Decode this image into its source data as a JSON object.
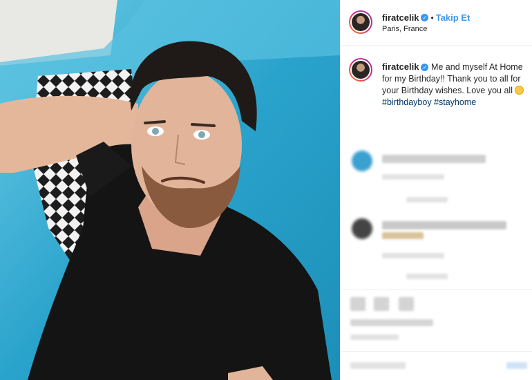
{
  "post": {
    "username": "firatcelik",
    "location": "Paris, France",
    "follow_label": "Takip Et",
    "separator": "•",
    "caption_text": "Me and myself At Home for my Birthday!! Thank you to all for your Birthday wishes. Love you all",
    "hashtags": "#birthdayboy #stayhome"
  },
  "colors": {
    "accent": "#3897f0",
    "hashtag": "#00376b",
    "photo_bg": "#3fb3d8"
  },
  "icons": {
    "verified": "verified-badge-icon",
    "emoji": "wink-emoji-icon"
  }
}
